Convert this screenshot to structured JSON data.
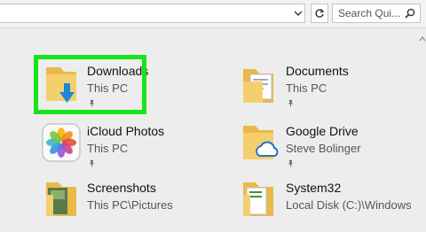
{
  "search": {
    "placeholder": "Search Qui..."
  },
  "quick_access": [
    {
      "name": "Downloads",
      "location": "This PC",
      "icon": "downloads-folder-icon"
    },
    {
      "name": "Documents",
      "location": "This PC",
      "icon": "documents-folder-icon"
    },
    {
      "name": "iCloud Photos",
      "location": "This PC",
      "icon": "icloud-photos-icon"
    },
    {
      "name": "Google Drive",
      "location": "Steve Bolinger",
      "icon": "google-drive-folder-icon"
    },
    {
      "name": "Screenshots",
      "location": "This PC\\Pictures",
      "icon": "screenshots-folder-icon"
    },
    {
      "name": "System32",
      "location": "Local Disk (C:)\\Windows",
      "icon": "system32-folder-icon"
    }
  ],
  "colors": {
    "highlight": "#17e41b",
    "folder": "#f4cf6e",
    "download_arrow": "#1e88d8"
  }
}
